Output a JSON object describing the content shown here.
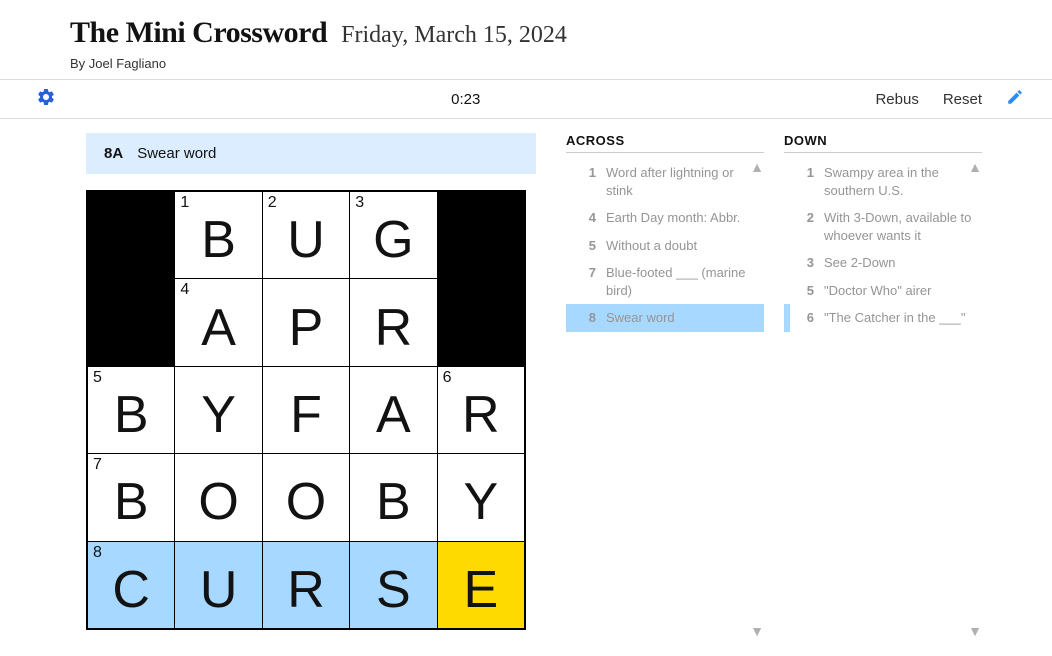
{
  "header": {
    "title": "The Mini Crossword",
    "date": "Friday, March 15, 2024",
    "byline": "By Joel Fagliano"
  },
  "toolbar": {
    "timer": "0:23",
    "rebus_label": "Rebus",
    "reset_label": "Reset"
  },
  "current_clue": {
    "number": "8A",
    "text": "Swear word"
  },
  "grid": {
    "rows": [
      [
        {
          "black": true
        },
        {
          "num": "1",
          "letter": "B"
        },
        {
          "num": "2",
          "letter": "U"
        },
        {
          "num": "3",
          "letter": "G"
        },
        {
          "black": true
        }
      ],
      [
        {
          "black": true
        },
        {
          "num": "4",
          "letter": "A"
        },
        {
          "letter": "P"
        },
        {
          "letter": "R"
        },
        {
          "black": true
        }
      ],
      [
        {
          "num": "5",
          "letter": "B"
        },
        {
          "letter": "Y"
        },
        {
          "letter": "F"
        },
        {
          "letter": "A"
        },
        {
          "num": "6",
          "letter": "R"
        }
      ],
      [
        {
          "num": "7",
          "letter": "B"
        },
        {
          "letter": "O"
        },
        {
          "letter": "O"
        },
        {
          "letter": "B"
        },
        {
          "letter": "Y"
        }
      ],
      [
        {
          "num": "8",
          "letter": "C",
          "hl": true
        },
        {
          "letter": "U",
          "hl": true
        },
        {
          "letter": "R",
          "hl": true
        },
        {
          "letter": "S",
          "hl": true
        },
        {
          "letter": "E",
          "cursor": true
        }
      ]
    ]
  },
  "clues": {
    "across_label": "ACROSS",
    "down_label": "DOWN",
    "across": [
      {
        "num": "1",
        "text": "Word after lightning or stink"
      },
      {
        "num": "4",
        "text": "Earth Day month: Abbr."
      },
      {
        "num": "5",
        "text": "Without a doubt"
      },
      {
        "num": "7",
        "text": "Blue-footed ___ (marine bird)"
      },
      {
        "num": "8",
        "text": "Swear word",
        "selected": true
      }
    ],
    "down": [
      {
        "num": "1",
        "text": "Swampy area in the southern U.S."
      },
      {
        "num": "2",
        "text": "With 3-Down, available to whoever wants it"
      },
      {
        "num": "3",
        "text": "See 2-Down"
      },
      {
        "num": "5",
        "text": "\"Doctor Who\" airer"
      },
      {
        "num": "6",
        "text": "\"The Catcher in the ___\"",
        "related": true
      }
    ]
  }
}
